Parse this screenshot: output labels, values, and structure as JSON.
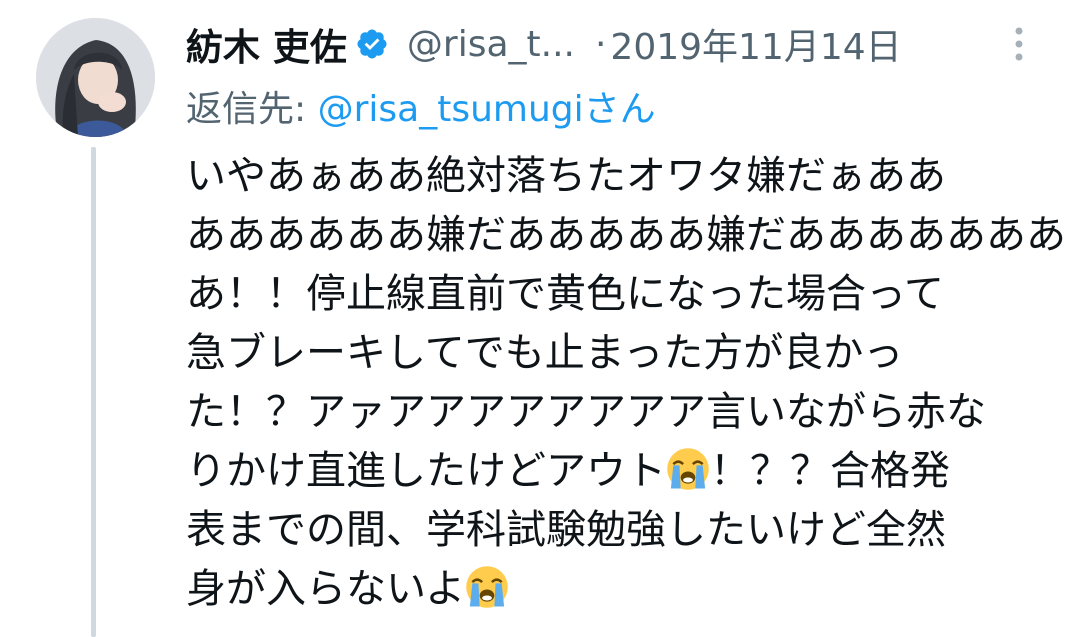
{
  "tweet": {
    "author": {
      "display_name": "紡木 吏佐",
      "handle": "@risa_t...",
      "verified": true
    },
    "separator": "·",
    "date": "2019年11月14日",
    "reply_prefix": "返信先: ",
    "reply_target": "@risa_tsumugiさん",
    "text_lines": [
      "いやあぁああ絶対落ちたオワタ嫌だぁああ",
      "ああああああ嫌だあああああ嫌だあああああああ",
      "あ！！停止線直前で黄色になった場合って",
      "急ブレーキしてでも止まった方が良かっ",
      "た！？アァアアアアアアアア言いながら赤な",
      "りかけ直進したけどアウト",
      "！？？合格発",
      "表までの間、学科試験勉強したいけど全然",
      "身が入らないよ"
    ]
  },
  "icons": {
    "avatar": "user-avatar",
    "verified": "verified-badge-icon",
    "more": "more-options-icon",
    "emoji": "loudly-crying-face-emoji"
  },
  "colors": {
    "text": "#0f1419",
    "secondary": "#536471",
    "link": "#1d9bf0",
    "thread_line": "#cfd9de"
  }
}
